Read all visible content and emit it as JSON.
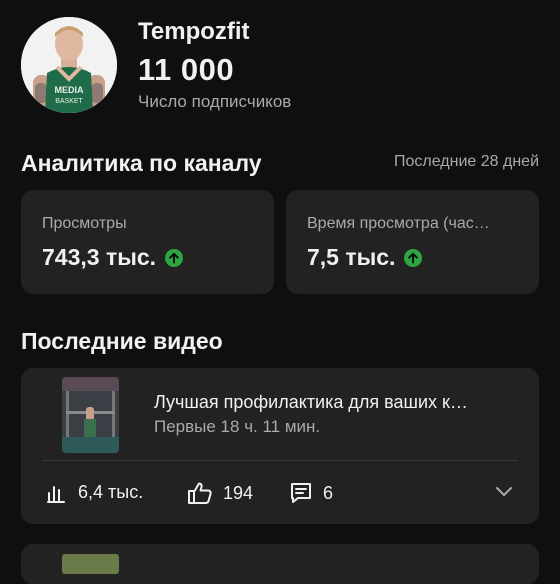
{
  "channel": {
    "name": "Tempozfit",
    "subscribers": "11 000",
    "subscribers_label": "Число подписчиков",
    "avatar_text": "MEDIA BASKET"
  },
  "analytics": {
    "title": "Аналитика по каналу",
    "period": "Последние 28 дней",
    "cards": [
      {
        "label": "Просмотры",
        "value": "743,3 тыс.",
        "trend": "up"
      },
      {
        "label": "Время просмотра (час…",
        "value": "7,5 тыс.",
        "trend": "up"
      }
    ]
  },
  "recent_videos": {
    "title": "Последние видео",
    "items": [
      {
        "title": "Лучшая профилактика для ваших к…",
        "time": "Первые 18 ч. 11 мин.",
        "views": "6,4 тыс.",
        "likes": "194",
        "comments": "6"
      }
    ]
  },
  "colors": {
    "background": "#0f0f0f",
    "card": "#222222",
    "secondary_text": "#aaaaaa",
    "trend_up": "#2ba640"
  },
  "icons": [
    "trend-up-icon",
    "views-bars-icon",
    "like-icon",
    "comment-icon",
    "chevron-down-icon"
  ]
}
